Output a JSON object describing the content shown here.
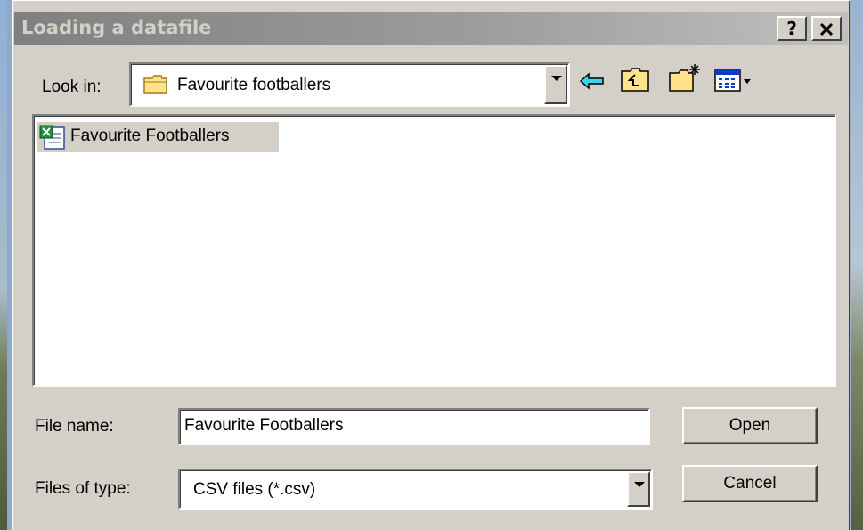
{
  "dialog": {
    "title": "Loading a datafile",
    "help_label": "?",
    "close_label": "✕"
  },
  "look_in": {
    "label": "Look in:",
    "value": "Favourite footballers"
  },
  "toolbar": {
    "icons": [
      "back-icon",
      "up-one-level-icon",
      "create-new-folder-icon",
      "view-menu-icon"
    ]
  },
  "files": [
    {
      "name": "Favourite Footballers",
      "icon": "excel-csv-file-icon",
      "selected": true
    }
  ],
  "file_name": {
    "label": "File name:",
    "value": "Favourite Footballers"
  },
  "file_type": {
    "label": "Files of type:",
    "value": "CSV files (*.csv)"
  },
  "buttons": {
    "open_label": "Open",
    "cancel_label": "Cancel"
  },
  "colors": {
    "dialog_face": "#d4d0c8",
    "titlebar_inactive": "#808080",
    "selection": "#d4d0c8"
  }
}
